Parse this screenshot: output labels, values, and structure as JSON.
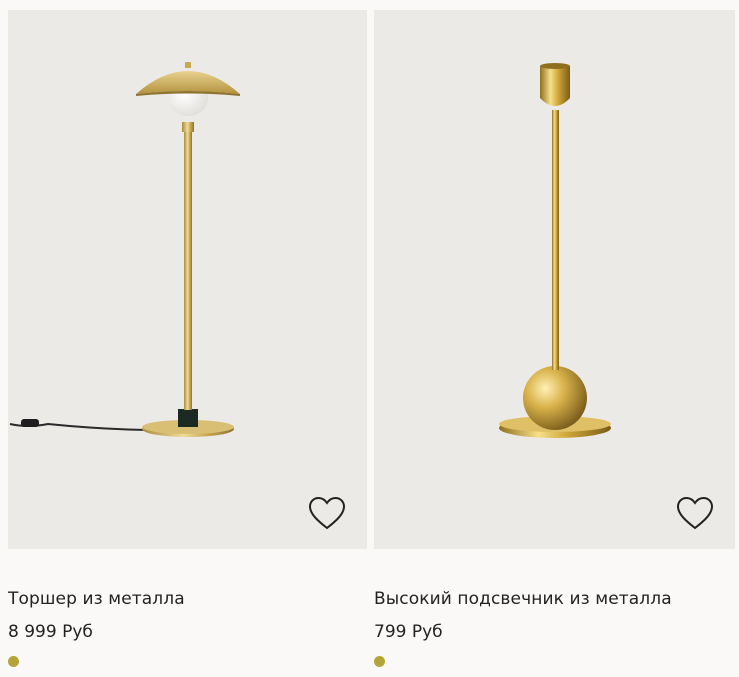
{
  "products": [
    {
      "name": "Торшер из металла",
      "price": "8 999 Руб",
      "swatch_color": "#b4a43a",
      "favorite_icon": "heart-outline-icon"
    },
    {
      "name": "Высокий подсвечник из металла",
      "price": "799 Руб",
      "swatch_color": "#b4a43a",
      "favorite_icon": "heart-outline-icon"
    }
  ]
}
